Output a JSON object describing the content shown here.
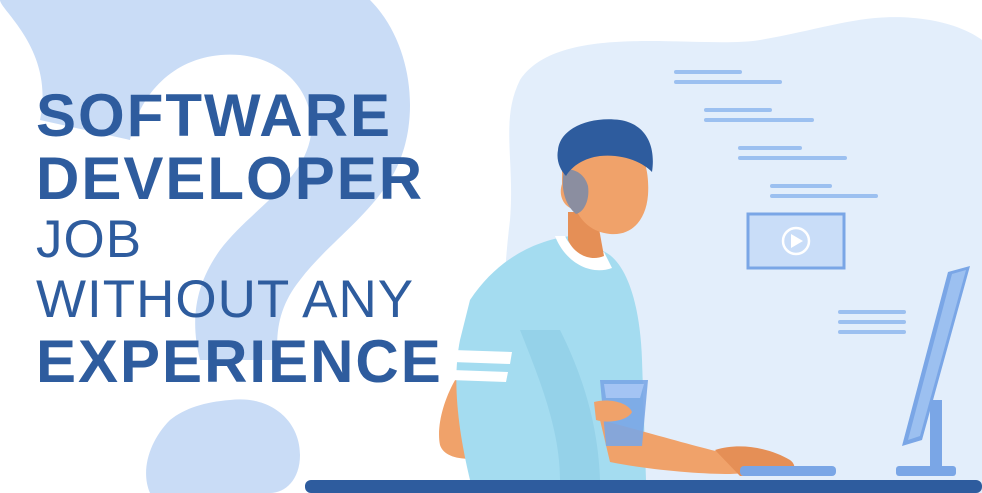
{
  "headline": {
    "line1": "SOFTWARE",
    "line2": "DEVELOPER",
    "line3": "JOB",
    "line4": "WITHOUT ANY",
    "line5": "EXPERIENCE"
  },
  "colors": {
    "headline": "#2e5c9e",
    "background_blob": "#e3eefb",
    "question_mark": "#c9dcf6",
    "shirt": "#a4dcf0",
    "skin": "#f0a26a",
    "hair": "#2e5c9e",
    "desk": "#2e5c9e",
    "monitor": "#7aa6e6",
    "code_lines": "#9cc0f0"
  },
  "icons": {
    "video_card": "play-icon"
  }
}
